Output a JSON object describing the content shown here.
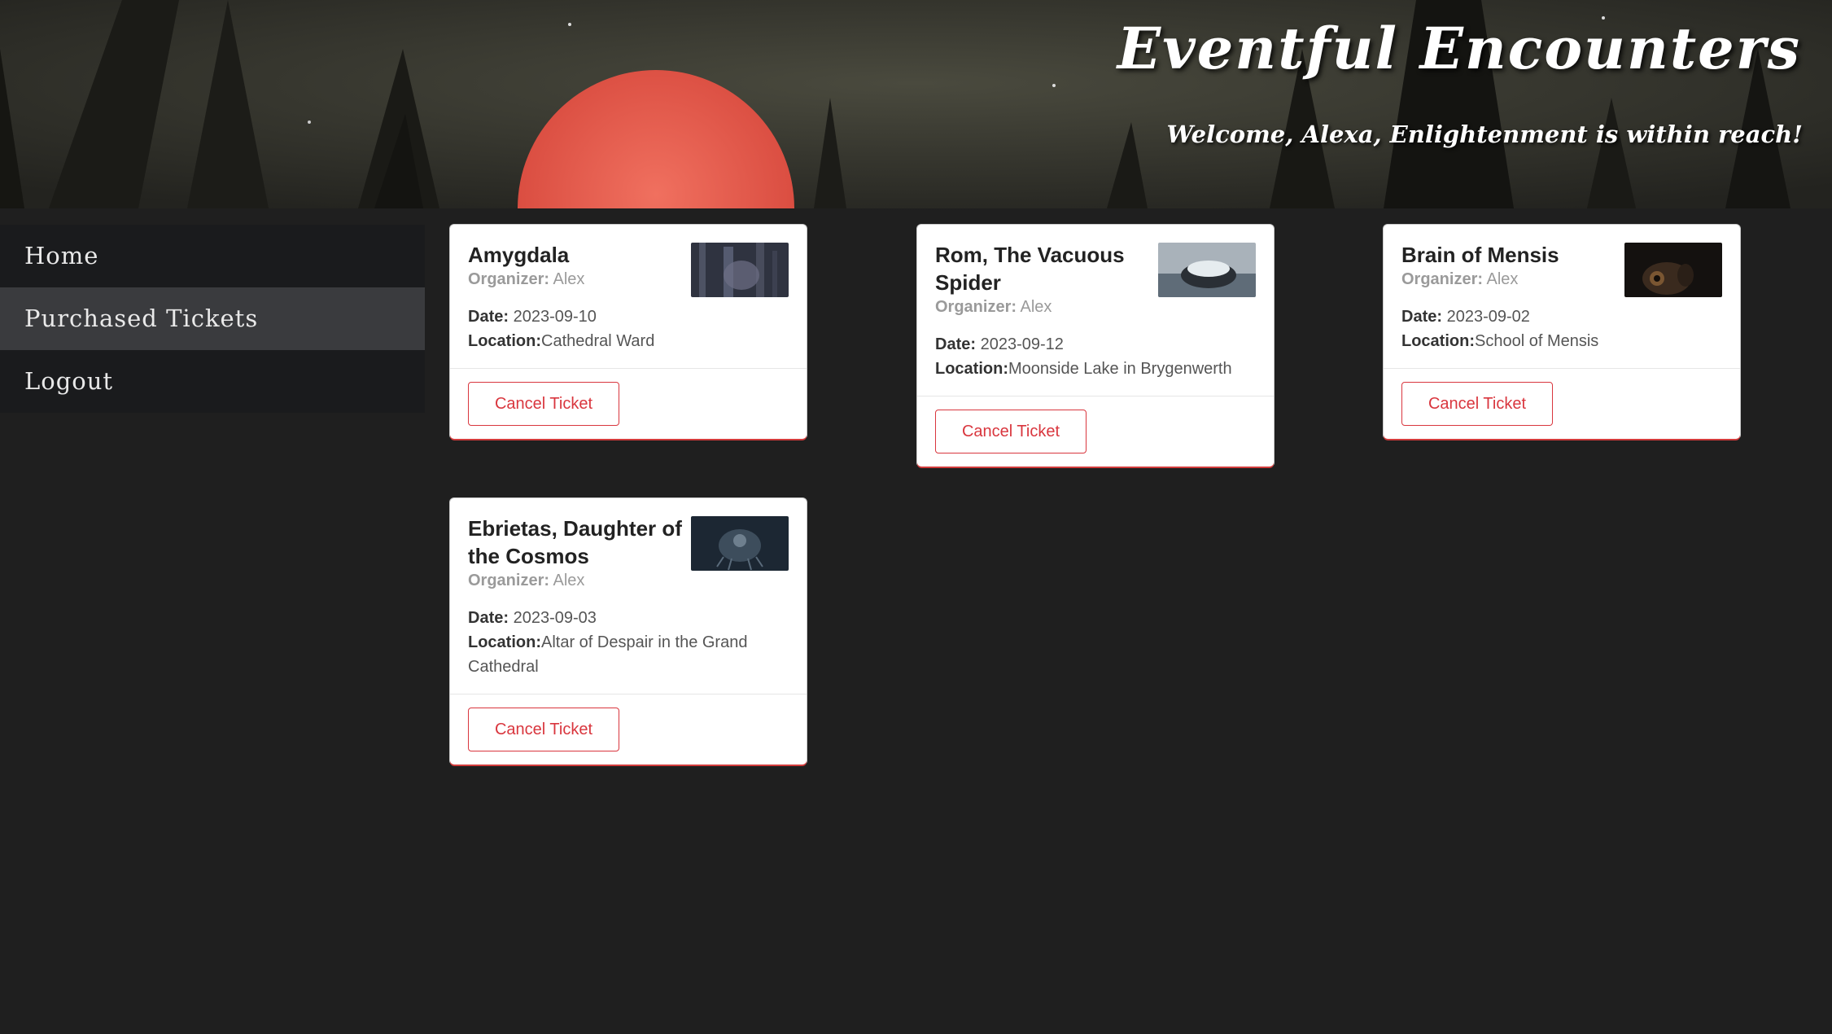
{
  "header": {
    "title": "Eventful Encounters",
    "welcome": "Welcome, Alexa, Enlightenment is within reach!"
  },
  "sidebar": {
    "items": [
      {
        "label": "Home",
        "active": false
      },
      {
        "label": "Purchased Tickets",
        "active": true
      },
      {
        "label": "Logout",
        "active": false
      }
    ]
  },
  "labels": {
    "organizer": "Organizer:",
    "date": "Date:",
    "location": "Location:",
    "cancel": "Cancel Ticket"
  },
  "tickets": [
    {
      "name": "Amygdala",
      "organizer": "Alex",
      "date": "2023-09-10",
      "location": "Cathedral Ward",
      "thumb_icon": "amygdala-thumbnail"
    },
    {
      "name": "Rom, The Vacuous Spider",
      "organizer": "Alex",
      "date": "2023-09-12",
      "location": "Moonside Lake in Brygenwerth",
      "thumb_icon": "rom-thumbnail"
    },
    {
      "name": "Brain of Mensis",
      "organizer": "Alex",
      "date": "2023-09-02",
      "location": "School of Mensis",
      "thumb_icon": "mensis-thumbnail"
    },
    {
      "name": "Ebrietas, Daughter of the Cosmos",
      "organizer": "Alex",
      "date": "2023-09-03",
      "location": "Altar of Despair in the Grand Cathedral",
      "thumb_icon": "ebrietas-thumbnail"
    }
  ],
  "colors": {
    "page_background": "#1f1f1f",
    "sidebar_background": "#1a1b1d",
    "sidebar_active": "#3a3b3e",
    "accent_red": "#d9363e",
    "moon": "#e8594c"
  }
}
